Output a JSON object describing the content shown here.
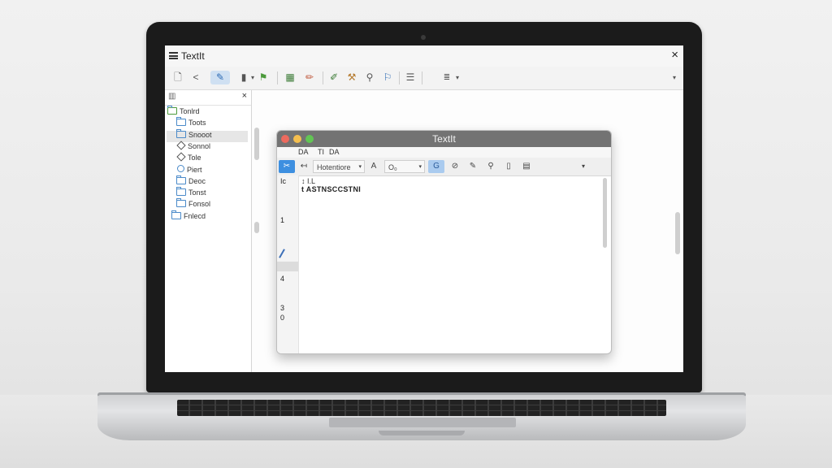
{
  "app": {
    "title": "TextIt",
    "close_glyph": "×",
    "toolbar": [
      {
        "name": "new-file-icon",
        "glyph": "🗋"
      },
      {
        "name": "share-icon",
        "glyph": "<"
      },
      {
        "name": "pen-icon",
        "glyph": "✎"
      },
      {
        "name": "folder-icon",
        "glyph": "▮"
      },
      {
        "name": "dropdown-icon",
        "glyph": "▾"
      },
      {
        "name": "paint-icon",
        "glyph": "⚑"
      },
      {
        "name": "grid-icon",
        "glyph": "▦"
      },
      {
        "name": "pencil-icon",
        "glyph": "✏"
      },
      {
        "name": "edit-icon",
        "glyph": "✐"
      },
      {
        "name": "tool-icon",
        "glyph": "⚒"
      },
      {
        "name": "search-icon",
        "glyph": "⚲"
      },
      {
        "name": "flag-icon",
        "glyph": "⚐"
      },
      {
        "name": "list-icon",
        "glyph": "☰"
      },
      {
        "name": "format-icon",
        "glyph": "≣"
      },
      {
        "name": "more-dropdown-icon",
        "glyph": "▾"
      },
      {
        "name": "overflow-icon",
        "glyph": "▾"
      }
    ]
  },
  "sidebar": {
    "header_icon": "▥",
    "close_glyph": "×",
    "root": "Tonlrd",
    "items": [
      {
        "label": "Toots",
        "icon": "folder"
      },
      {
        "label": "Snooot",
        "icon": "folder",
        "selected": true
      },
      {
        "label": "Sonnol",
        "icon": "diamond"
      },
      {
        "label": "Tole",
        "icon": "diamond"
      },
      {
        "label": "Piert",
        "icon": "circle"
      },
      {
        "label": "Deoc",
        "icon": "folder"
      },
      {
        "label": "Tonst",
        "icon": "folder"
      },
      {
        "label": "Fonsol",
        "icon": "folder"
      },
      {
        "label": "Fnlecd",
        "icon": "folder"
      }
    ]
  },
  "inner": {
    "title": "TextIt",
    "menu": [
      "DA",
      "TI",
      "DA"
    ],
    "toolbar": {
      "cut": "✂",
      "back": "↤",
      "font_name": "Hotentiore",
      "font_icon": "A",
      "size": "O₀",
      "color_icon": "G",
      "brush_icon": "⊘",
      "pen_icon": "✎",
      "zoom_icon": "⚲",
      "page_icon": "▯",
      "table_icon": "▤",
      "more": "▾"
    },
    "ruler": "↕ I.L",
    "first_line": "t  ASTNSCCSTNI",
    "gutter": {
      "top": "Ic",
      "numbers": [
        "1",
        "4",
        "3",
        "0"
      ]
    }
  },
  "colors": {
    "accent": "#3d8fe0",
    "titlebar": "#737373",
    "traffic_red": "#ed6a5e",
    "traffic_yellow": "#f5bf4f",
    "traffic_green": "#62c554"
  }
}
